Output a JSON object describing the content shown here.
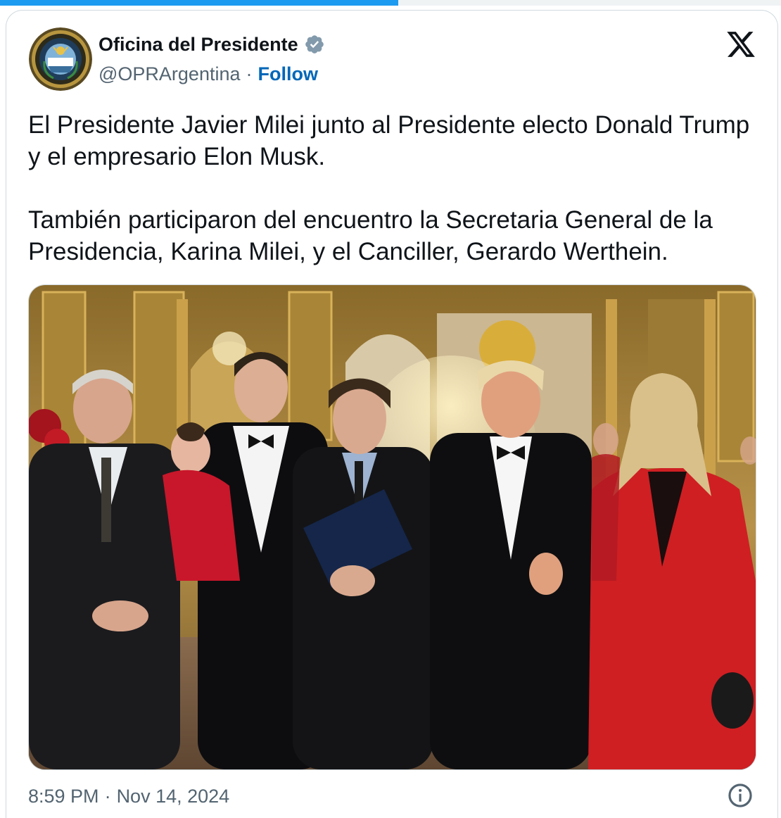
{
  "progress": {
    "fraction": 0.51
  },
  "author": {
    "display_name": "Oficina del Presidente",
    "handle": "@OPRArgentina",
    "separator": "·",
    "follow_label": "Follow",
    "avatar_icon": "presidential-seal-icon",
    "verified_icon": "verified-badge-icon"
  },
  "platform": {
    "logo_icon": "x-logo-icon"
  },
  "tweet": {
    "paragraph_1": "El Presidente Javier Milei junto al Presidente electo Donald Trump y el empresario Elon Musk.",
    "paragraph_2": "También participaron del encuentro la Secretaria General de la Presidencia, Karina Milei, y el Canciller, Gerardo Werthein."
  },
  "media": {
    "photo_icon": "group-photo-icon"
  },
  "footer": {
    "time": "8:59 PM",
    "separator": "·",
    "date": "Nov 14, 2024",
    "info_icon": "info-icon"
  },
  "colors": {
    "accent": "#1d9bf0",
    "follow": "#0067b8",
    "secondary_text": "#536471",
    "verified": "#829aab",
    "border": "#cfd9de"
  }
}
